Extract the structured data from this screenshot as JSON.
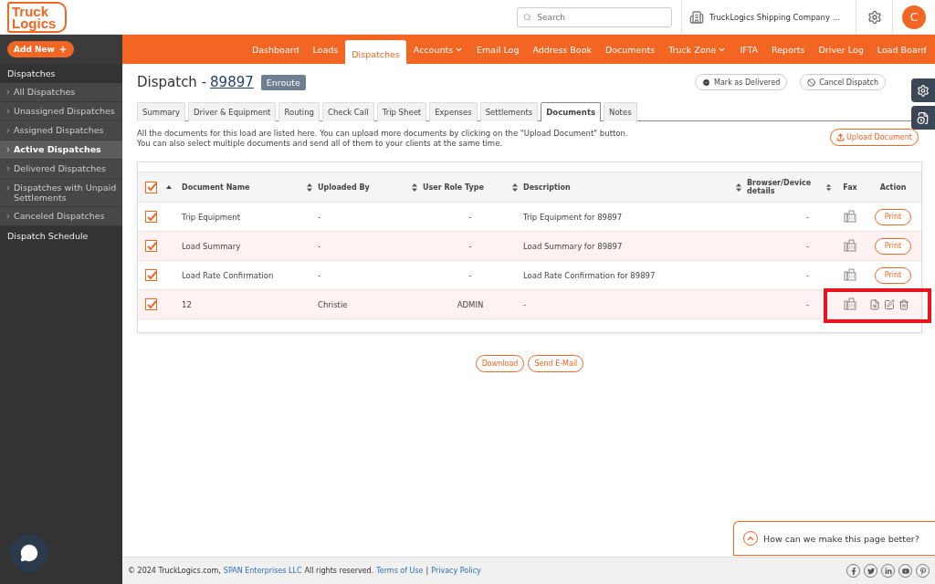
{
  "header": {
    "logo": [
      "Truck",
      "Logics"
    ],
    "search": {
      "placeholder": "Search"
    },
    "company": "TruckLogics Shipping Company ...",
    "avatar": "C"
  },
  "add_new": "Add New",
  "nav": [
    {
      "label": "Dashboard",
      "selected": false,
      "dropdown": false
    },
    {
      "label": "Loads",
      "selected": false,
      "dropdown": false
    },
    {
      "label": "Dispatches",
      "selected": true,
      "dropdown": false
    },
    {
      "label": "Accounts",
      "selected": false,
      "dropdown": true
    },
    {
      "label": "Email Log",
      "selected": false,
      "dropdown": false
    },
    {
      "label": "Address Book",
      "selected": false,
      "dropdown": false
    },
    {
      "label": "Documents",
      "selected": false,
      "dropdown": false
    },
    {
      "label": "Truck Zone",
      "selected": false,
      "dropdown": true
    },
    {
      "label": "IFTA",
      "selected": false,
      "dropdown": false
    },
    {
      "label": "Reports",
      "selected": false,
      "dropdown": false
    },
    {
      "label": "Driver Log",
      "selected": false,
      "dropdown": false
    },
    {
      "label": "Load Board",
      "selected": false,
      "dropdown": false
    }
  ],
  "sidebar": {
    "sections": [
      {
        "title": "Dispatches",
        "items": [
          {
            "label": "All Dispatches",
            "selected": false
          },
          {
            "label": "Unassigned Dispatches",
            "selected": false
          },
          {
            "label": "Assigned Dispatches",
            "selected": false
          },
          {
            "label": "Active Dispatches",
            "selected": true
          },
          {
            "label": "Delivered Dispatches",
            "selected": false
          },
          {
            "label": "Dispatches with Unpaid Settlements",
            "selected": false
          },
          {
            "label": "Canceled Dispatches",
            "selected": false
          }
        ]
      },
      {
        "title": "Dispatch Schedule"
      }
    ]
  },
  "dispatch": {
    "title": "Dispatch -",
    "number": "89897",
    "status": "Enroute",
    "actions": [
      {
        "kind": "deliver",
        "label": "Mark as Delivered"
      },
      {
        "kind": "cancel",
        "label": "Cancel Dispatch"
      }
    ]
  },
  "tabs": [
    {
      "label": "Summary",
      "selected": false
    },
    {
      "label": "Driver & Equipment",
      "selected": false
    },
    {
      "label": "Routing",
      "selected": false
    },
    {
      "label": "Check Call",
      "selected": false
    },
    {
      "label": "Trip Sheet",
      "selected": false
    },
    {
      "label": "Expenses",
      "selected": false
    },
    {
      "label": "Settlements",
      "selected": false
    },
    {
      "label": "Documents",
      "selected": true
    },
    {
      "label": "Notes",
      "selected": false
    }
  ],
  "intro": [
    "All the documents for this load are listed here. You can upload more documents by clicking on the \"Upload Document\" button.",
    "You can also select multiple documents and send all of them to your clients at the same time."
  ],
  "upload_button": "Upload Document",
  "table": {
    "all_checked": true,
    "columns": [
      "Document Name",
      "Uploaded By",
      "User Role Type",
      "Description",
      "Browser/Device details",
      "Fax",
      "Action"
    ],
    "rows": [
      {
        "checked": true,
        "kind": "print",
        "highlighted": false,
        "cells": [
          "Trip Equipment",
          "-",
          "-",
          "Trip Equipment for 89897",
          "-"
        ],
        "action": "Print"
      },
      {
        "checked": true,
        "kind": "print",
        "highlighted": false,
        "cells": [
          "Load Summary",
          "-",
          "-",
          "Load Summary for 89897",
          "-"
        ],
        "action": "Print"
      },
      {
        "checked": true,
        "kind": "print",
        "highlighted": false,
        "cells": [
          "Load Rate Confirmation",
          "-",
          "-",
          "Load Rate Confirmation for 89897",
          "-"
        ],
        "action": "Print"
      },
      {
        "checked": true,
        "kind": "edit",
        "highlighted": true,
        "cells": [
          "12",
          "Christie",
          "ADMIN",
          "-",
          "-"
        ]
      }
    ]
  },
  "bottom_buttons": [
    "Download",
    "Send E-Mail"
  ],
  "feedback": "How can we make this page better?",
  "footer": {
    "copyright": "© 2024 TruckLogics.com,",
    "company_link": "SPAN Enterprises LLC",
    "rights": "All rights reserved.",
    "links": [
      "Terms of Use",
      "Privacy Policy"
    ],
    "separator": "|"
  }
}
